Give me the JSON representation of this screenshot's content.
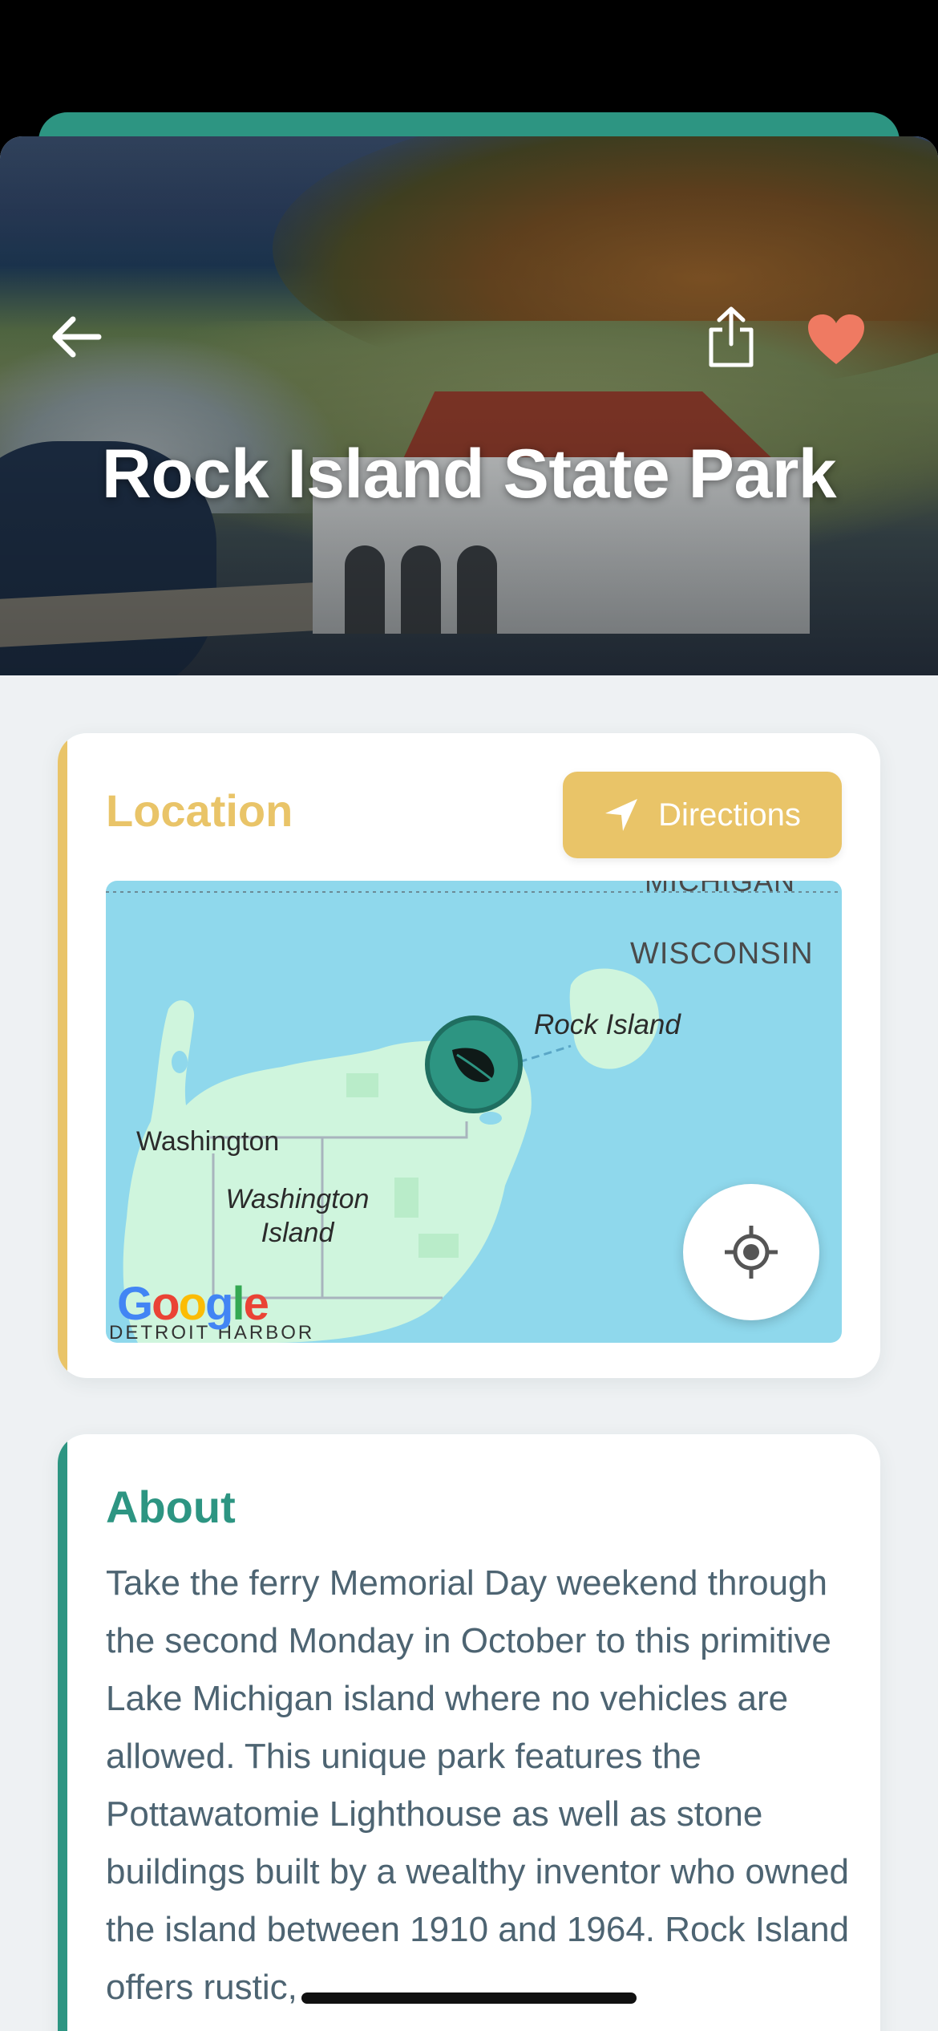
{
  "hero": {
    "title": "Rock Island State Park"
  },
  "location": {
    "title": "Location",
    "directions_label": "Directions",
    "map": {
      "labels": {
        "michigan": "MICHIGAN",
        "wisconsin": "WISCONSIN",
        "rock_island": "Rock Island",
        "washington": "Washington",
        "washington_island": "Washington Island",
        "detroit_harbor": "DETROIT HARBOR"
      },
      "attribution": "Google"
    }
  },
  "about": {
    "title": "About",
    "text": "Take the ferry Memorial Day weekend through the second Monday in October to this primitive Lake Michigan island where no vehicles are allowed. This unique park features the Pottawatomie Lighthouse as well as stone buildings built by a wealthy inventor who owned the island between 1910 and 1964. Rock Island offers rustic,"
  },
  "colors": {
    "accent_teal": "#2d9582",
    "accent_yellow": "#e9c468",
    "favorite": "#ef7a62",
    "body_text": "#4d6472"
  },
  "icons": [
    "back-arrow-icon",
    "share-icon",
    "heart-icon",
    "navigation-arrow-icon",
    "leaf-icon",
    "my-location-icon"
  ]
}
